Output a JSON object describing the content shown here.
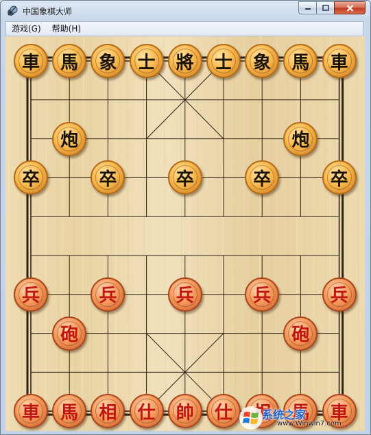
{
  "window": {
    "title": "中国象棋大师",
    "icon": "chess-app-icon",
    "buttons": {
      "minimize": "minimize-icon",
      "maximize": "maximize-icon",
      "close": "close-icon"
    }
  },
  "menu": {
    "items": [
      {
        "label": "游戏(G)"
      },
      {
        "label": "帮助(H)"
      }
    ]
  },
  "colors": {
    "board": "#ecdcb8",
    "line": "#2b2015",
    "black_piece_fill": "#f7b84d",
    "red_piece_fill": "#f59a5c",
    "red_text": "#c1160f",
    "black_text": "#1a1206"
  },
  "board": {
    "columns": 9,
    "rows": 10,
    "pieces": [
      {
        "char": "車",
        "side": "black",
        "col": 0,
        "row": 0
      },
      {
        "char": "馬",
        "side": "black",
        "col": 1,
        "row": 0
      },
      {
        "char": "象",
        "side": "black",
        "col": 2,
        "row": 0
      },
      {
        "char": "士",
        "side": "black",
        "col": 3,
        "row": 0
      },
      {
        "char": "將",
        "side": "black",
        "col": 4,
        "row": 0
      },
      {
        "char": "士",
        "side": "black",
        "col": 5,
        "row": 0
      },
      {
        "char": "象",
        "side": "black",
        "col": 6,
        "row": 0
      },
      {
        "char": "馬",
        "side": "black",
        "col": 7,
        "row": 0
      },
      {
        "char": "車",
        "side": "black",
        "col": 8,
        "row": 0
      },
      {
        "char": "炮",
        "side": "black",
        "col": 1,
        "row": 2
      },
      {
        "char": "炮",
        "side": "black",
        "col": 7,
        "row": 2
      },
      {
        "char": "卒",
        "side": "black",
        "col": 0,
        "row": 3
      },
      {
        "char": "卒",
        "side": "black",
        "col": 2,
        "row": 3
      },
      {
        "char": "卒",
        "side": "black",
        "col": 4,
        "row": 3
      },
      {
        "char": "卒",
        "side": "black",
        "col": 6,
        "row": 3
      },
      {
        "char": "卒",
        "side": "black",
        "col": 8,
        "row": 3
      },
      {
        "char": "兵",
        "side": "red",
        "col": 0,
        "row": 6
      },
      {
        "char": "兵",
        "side": "red",
        "col": 2,
        "row": 6
      },
      {
        "char": "兵",
        "side": "red",
        "col": 4,
        "row": 6
      },
      {
        "char": "兵",
        "side": "red",
        "col": 6,
        "row": 6
      },
      {
        "char": "兵",
        "side": "red",
        "col": 8,
        "row": 6
      },
      {
        "char": "砲",
        "side": "red",
        "col": 1,
        "row": 7
      },
      {
        "char": "砲",
        "side": "red",
        "col": 7,
        "row": 7
      },
      {
        "char": "車",
        "side": "red",
        "col": 0,
        "row": 9
      },
      {
        "char": "馬",
        "side": "red",
        "col": 1,
        "row": 9
      },
      {
        "char": "相",
        "side": "red",
        "col": 2,
        "row": 9
      },
      {
        "char": "仕",
        "side": "red",
        "col": 3,
        "row": 9
      },
      {
        "char": "帥",
        "side": "red",
        "col": 4,
        "row": 9
      },
      {
        "char": "仕",
        "side": "red",
        "col": 5,
        "row": 9
      },
      {
        "char": "相",
        "side": "red",
        "col": 6,
        "row": 9
      },
      {
        "char": "馬",
        "side": "red",
        "col": 7,
        "row": 9
      },
      {
        "char": "車",
        "side": "red",
        "col": 8,
        "row": 9
      }
    ]
  },
  "watermark": {
    "logo": "windows-logo-icon",
    "text": "系统之家",
    "url": "www.Winwin7.com"
  }
}
